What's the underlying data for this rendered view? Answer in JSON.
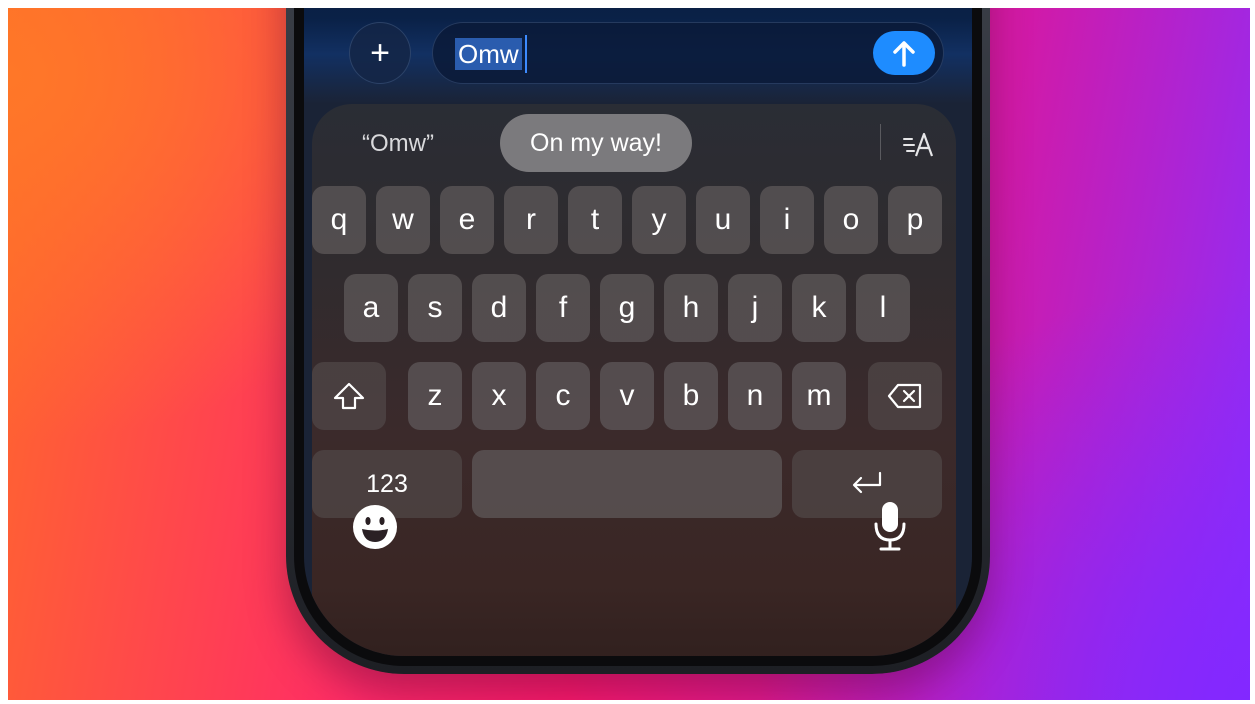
{
  "message": {
    "add_label": "+",
    "text": "Omw",
    "send_icon": "arrow-up-icon",
    "send_color": "#1e8cff"
  },
  "suggestions": {
    "typed": "“Omw”",
    "replacement": "On my way!",
    "format_icon": "text-format-icon"
  },
  "keyboard": {
    "row1": [
      "q",
      "w",
      "e",
      "r",
      "t",
      "y",
      "u",
      "i",
      "o",
      "p"
    ],
    "row2": [
      "a",
      "s",
      "d",
      "f",
      "g",
      "h",
      "j",
      "k",
      "l"
    ],
    "row3": [
      "z",
      "x",
      "c",
      "v",
      "b",
      "n",
      "m"
    ],
    "shift_icon": "shift-icon",
    "delete_icon": "delete-icon",
    "numbers_label": "123",
    "return_icon": "return-icon",
    "emoji_icon": "emoji-icon",
    "mic_icon": "microphone-icon"
  }
}
